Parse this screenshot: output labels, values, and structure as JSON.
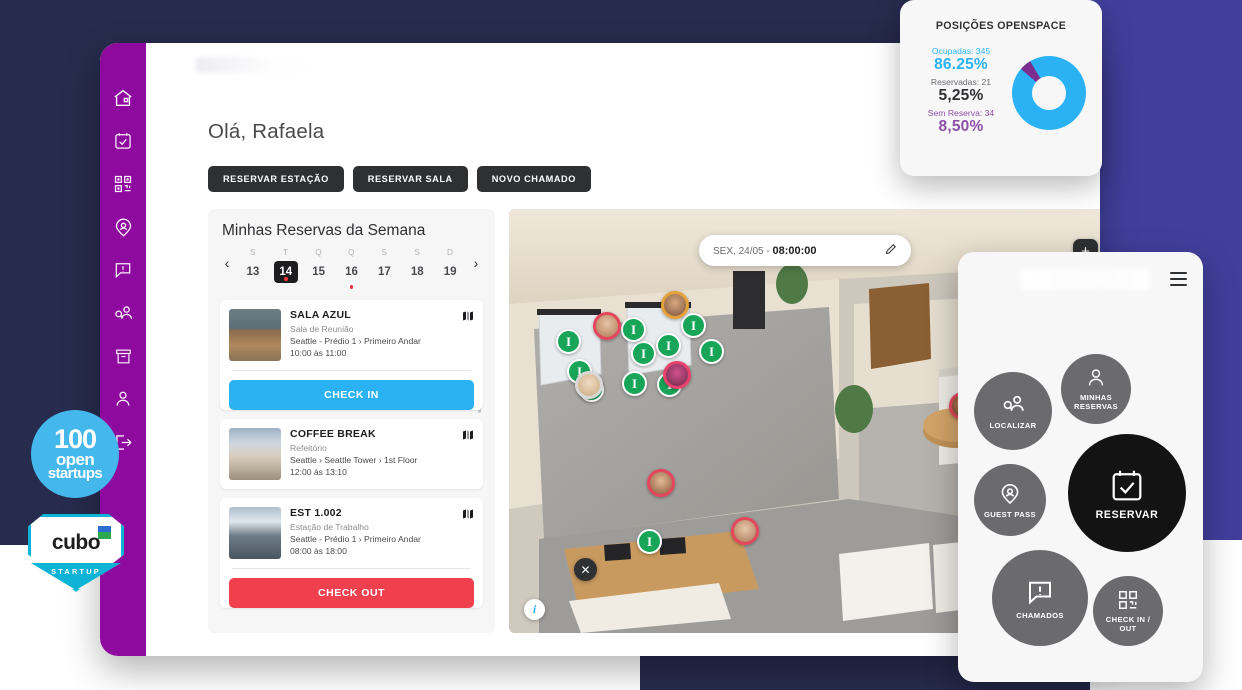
{
  "colors": {
    "background": "#272b4d",
    "indigo_band": "#413f9b",
    "sidebar_purple": "#8e0a9e",
    "accent_blue": "#2bb2f5",
    "accent_red": "#f0404e",
    "accent_green": "#18a558",
    "dark": "#2f3032",
    "purple_stat": "#8e4fa8"
  },
  "sidebar": {
    "items": [
      {
        "name": "home-icon",
        "label": "Home"
      },
      {
        "name": "calendar-check-icon",
        "label": "Reservas"
      },
      {
        "name": "qr-code-icon",
        "label": "Check in / out"
      },
      {
        "name": "guest-pass-icon",
        "label": "Guest Pass"
      },
      {
        "name": "chamados-icon",
        "label": "Chamados"
      },
      {
        "name": "locate-people-icon",
        "label": "Localizar"
      },
      {
        "name": "archive-icon",
        "label": "Arquivo"
      },
      {
        "name": "user-icon",
        "label": "Perfil"
      },
      {
        "name": "logout-icon",
        "label": "Sair"
      }
    ]
  },
  "header": {
    "greeting": "Olá, Rafaela"
  },
  "actions": [
    {
      "label": "RESERVAR ESTAÇÃO",
      "name": "reservar-estacao-button"
    },
    {
      "label": "RESERVAR SALA",
      "name": "reservar-sala-button"
    },
    {
      "label": "NOVO CHAMADO",
      "name": "novo-chamado-button"
    }
  ],
  "reservations": {
    "title": "Minhas Reservas da Semana",
    "prev_label": "‹",
    "next_label": "›",
    "week": [
      {
        "dow": "S",
        "day": "13",
        "selected": false,
        "has_event": false
      },
      {
        "dow": "T",
        "day": "14",
        "selected": true,
        "has_event": true
      },
      {
        "dow": "Q",
        "day": "15",
        "selected": false,
        "has_event": false
      },
      {
        "dow": "Q",
        "day": "16",
        "selected": false,
        "has_event": true
      },
      {
        "dow": "S",
        "day": "17",
        "selected": false,
        "has_event": false
      },
      {
        "dow": "S",
        "day": "18",
        "selected": false,
        "has_event": false
      },
      {
        "dow": "D",
        "day": "19",
        "selected": false,
        "has_event": false
      }
    ],
    "cards": [
      {
        "name": "SALA AZUL",
        "type": "Sala de Reunião",
        "location": "Seattle - Prédio 1 › Primeiro Andar",
        "time": "10:00 às 11:00",
        "action": "CHECK IN",
        "action_style": "blue"
      },
      {
        "name": "COFFEE BREAK",
        "type": "Refeitório",
        "location": "Seattle › Seattle Tower › 1st Floor",
        "time": "12:00 às 13:10",
        "action": null,
        "action_style": null
      },
      {
        "name": "EST 1.002",
        "type": "Estação de Trabalho",
        "location": "Seattle - Prédio 1 › Primeiro Andar",
        "time": "08:00 às 18:00",
        "action": "CHECK OUT",
        "action_style": "red"
      }
    ]
  },
  "map": {
    "time_prefix": "SEX, 24/05 - ",
    "time_value": "08:00:00",
    "edit_icon": "pencil-icon",
    "zoom_in_label": "+",
    "close_label": "✕",
    "info_label": "i",
    "marker_label": "(I)",
    "free_markers": 11,
    "occupied_avatars": 7
  },
  "dashboard": {
    "title": "POSIÇÕES OPENSPACE",
    "stats": [
      {
        "label": "Ocupadas: 345",
        "value": "86.25%",
        "color_class": "blue",
        "pct": 86.25
      },
      {
        "label": "Reservadas: 21",
        "value": "5,25%",
        "color_class": "dark",
        "pct": 5.25
      },
      {
        "label": "Sem Reserva: 34",
        "value": "8,50%",
        "color_class": "purple",
        "pct": 8.5
      }
    ]
  },
  "mobile": {
    "menu_icon": "hamburger-menu-icon",
    "buttons": [
      {
        "label": "LOCALIZAR",
        "icon": "locate-people-icon",
        "style": "gray"
      },
      {
        "label": "MINHAS\nRESERVAS",
        "label_line1": "MINHAS",
        "label_line2": "RESERVAS",
        "icon": "user-icon",
        "style": "gray"
      },
      {
        "label": "GUEST PASS",
        "icon": "guest-pass-icon",
        "style": "gray"
      },
      {
        "label": "RESERVAR",
        "icon": "calendar-check-icon",
        "style": "black"
      },
      {
        "label": "CHAMADOS",
        "icon": "chamados-icon",
        "style": "gray"
      },
      {
        "label_line1": "CHECK IN /",
        "label_line2": "OUT",
        "icon": "qr-code-icon",
        "style": "gray"
      }
    ]
  },
  "logos": {
    "open_startups": {
      "line1": "100",
      "line2": "open",
      "line3": "startups"
    },
    "cubo": {
      "text": "cubo",
      "sub": "STARTUP"
    }
  }
}
